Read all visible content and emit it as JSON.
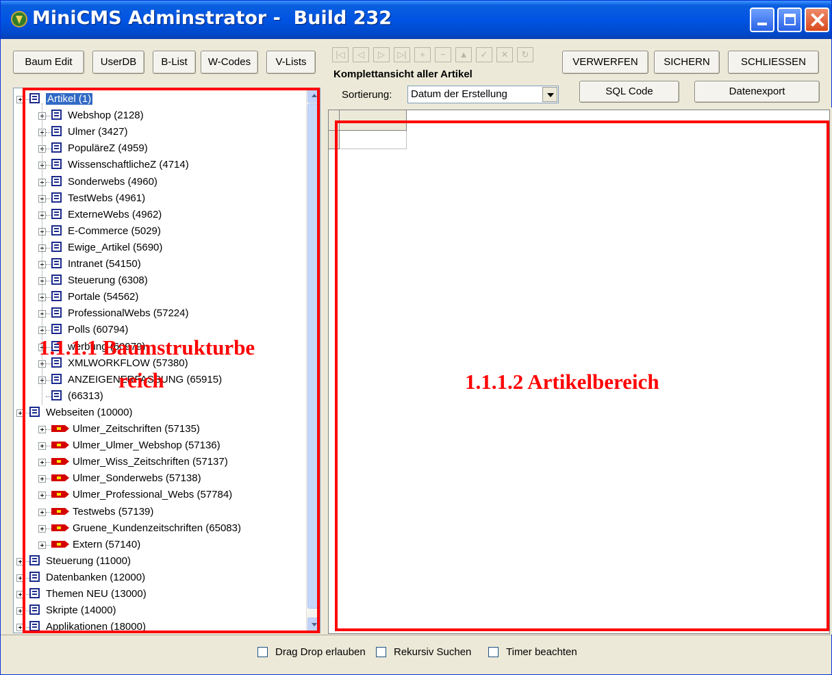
{
  "window": {
    "title": "MiniCMS Adminstrator -  Build 232"
  },
  "toolbar_left": {
    "baum_edit": "Baum Edit",
    "userdb": "UserDB",
    "blist": "B-List",
    "wcodes": "W-Codes",
    "vlists": "V-Lists"
  },
  "toolbar_right": {
    "verwerfen": "VERWERFEN",
    "sichern": "SICHERN",
    "schliessen": "SCHLIESSEN",
    "sql_code": "SQL Code",
    "datenexport": "Datenexport",
    "view_title": "Komplettansicht aller Artikel",
    "sort_label": "Sortierung:",
    "sort_value": "Datum der Erstellung"
  },
  "nav_buttons": [
    "|◁",
    "◁",
    "▷",
    "▷|",
    "+",
    "−",
    "▲",
    "✓",
    "✕",
    "↻"
  ],
  "tree": {
    "root_artikel": "Artikel (1)",
    "artikel_children": [
      "Webshop (2128)",
      "Ulmer (3427)",
      "PopuläreZ (4959)",
      "WissenschaftlicheZ (4714)",
      "Sonderwebs (4960)",
      "TestWebs (4961)",
      "ExterneWebs (4962)",
      "E-Commerce (5029)",
      "Ewige_Artikel (5690)",
      "Intranet (54150)",
      "Steuerung (6308)",
      "Portale (54562)",
      "ProfessionalWebs (57224)",
      "Polls (60794)",
      "werbung (60979)",
      "XMLWORKFLOW (57380)",
      "ANZEIGENERFASSUNG (65915)",
      " (66313)"
    ],
    "root_webseiten": "Webseiten (10000)",
    "webseiten_children": [
      "Ulmer_Zeitschriften (57135)",
      "Ulmer_Ulmer_Webshop (57136)",
      "Ulmer_Wiss_Zeitschriften (57137)",
      "Ulmer_Sonderwebs (57138)",
      "Ulmer_Professional_Webs (57784)",
      "Testwebs (57139)",
      "Gruene_Kundenzeitschriften (65083)",
      "Extern (57140)"
    ],
    "other_roots": [
      "Steuerung (11000)",
      "Datenbanken (12000)",
      "Themen NEU (13000)",
      "Skripte (14000)",
      "Applikationen (18000)"
    ]
  },
  "annotations": {
    "tree_label_line1": "1.1.1.1 Baumstrukturbe",
    "tree_label_line2": "reich",
    "article_label": "1.1.1.2  Artikelbereich",
    "color": "#ff0000"
  },
  "footer": {
    "drag_drop": "Drag Drop erlauben",
    "rekursiv": "Rekursiv Suchen",
    "timer": "Timer beachten"
  },
  "colors": {
    "titlebar": "#0054e3",
    "selection": "#316ac5",
    "window_bg": "#ece9d8"
  }
}
